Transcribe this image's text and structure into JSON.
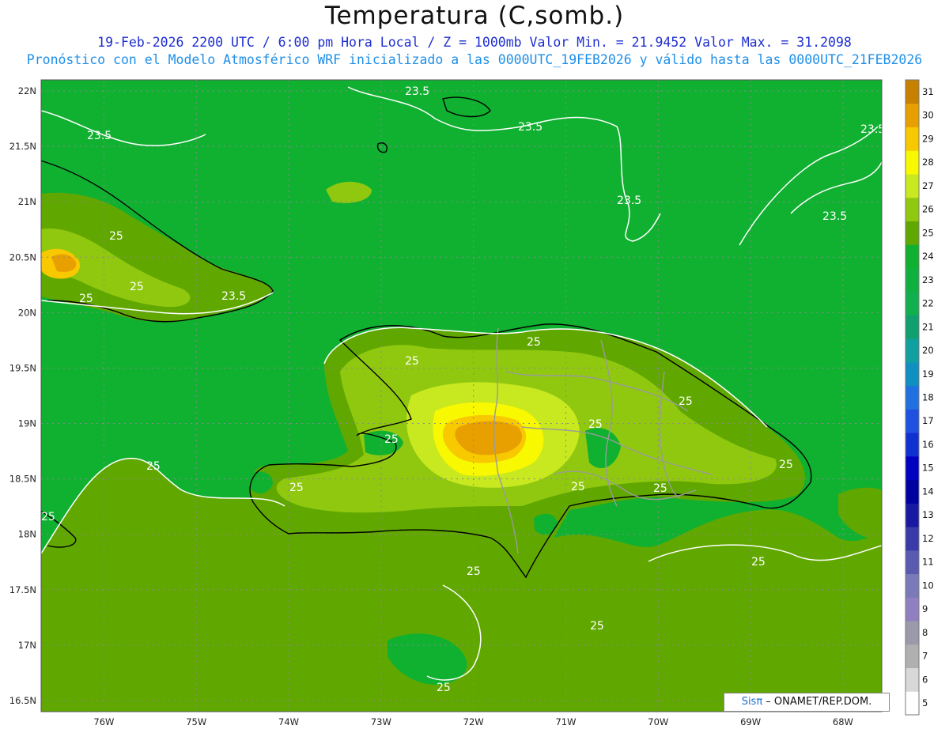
{
  "title": "Temperatura (C,somb.)",
  "subtitle_line1": "19-Feb-2026  2200 UTC / 6:00 pm Hora Local / Z = 1000mb   Valor Min. = 21.9452  Valor Max. = 31.2098",
  "subtitle_line2": "Pronóstico con el Modelo Atmosférico WRF inicializado a las 0000UTC_19FEB2026 y válido hasta las  0000UTC_21FEB2026",
  "credit": {
    "sis": "Sisπ",
    "rest": " – ONAMET/REP.DOM."
  },
  "lat_labels": [
    "22N",
    "21.5N",
    "21N",
    "20.5N",
    "20N",
    "19.5N",
    "19N",
    "18.5N",
    "18N",
    "17.5N",
    "17N",
    "16.5N"
  ],
  "lon_labels": [
    "76W",
    "75W",
    "74W",
    "73W",
    "72W",
    "71W",
    "70W",
    "69W",
    "68W"
  ],
  "colorbar": {
    "values": [
      "5",
      "6",
      "7",
      "8",
      "9",
      "10",
      "11",
      "12",
      "13",
      "14",
      "15",
      "16",
      "17",
      "18",
      "19",
      "20",
      "21",
      "22",
      "23",
      "24",
      "25",
      "26",
      "27",
      "28",
      "29",
      "30",
      "31"
    ],
    "colors": [
      "#ffffff",
      "#d8d8d8",
      "#b0b0b0",
      "#9a9aaa",
      "#9080c0",
      "#7a7ab8",
      "#5a5ab0",
      "#3a3aa8",
      "#1818a0",
      "#0000a0",
      "#0000c0",
      "#1030d0",
      "#2050e0",
      "#2070e0",
      "#1090c0",
      "#10a0a0",
      "#10a070",
      "#10b050",
      "#10b040",
      "#10b030",
      "#60a800",
      "#90c810",
      "#c8e820",
      "#f8f800",
      "#f8c800",
      "#e8a000",
      "#c88000"
    ]
  },
  "contour_labels": [
    "23.5",
    "23.5",
    "23.5",
    "23.5",
    "23.5",
    "23.5",
    "25",
    "25",
    "25",
    "25",
    "25",
    "25",
    "25",
    "25",
    "25",
    "25",
    "25",
    "25",
    "25",
    "25",
    "25",
    "25",
    "25",
    "25"
  ]
}
